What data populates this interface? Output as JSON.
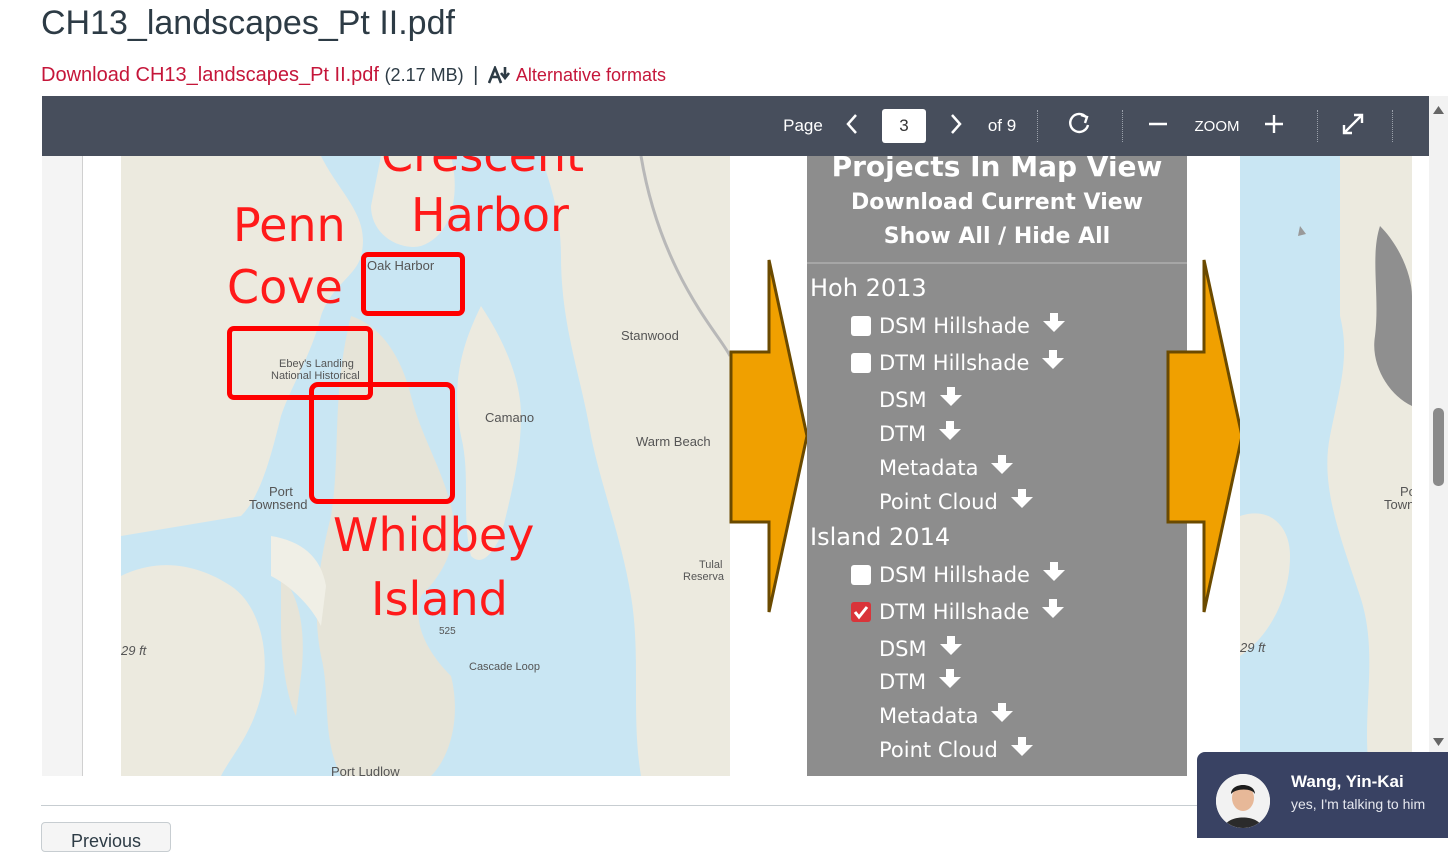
{
  "file": {
    "title": "CH13_landscapes_Pt II.pdf",
    "download_label": "Download CH13_landscapes_Pt II.pdf",
    "size": "(2.17 MB)",
    "separator": "|",
    "alt_formats_label": "Alternative formats",
    "alt_formats_icon": "accessibility-download-icon"
  },
  "toolbar": {
    "page_label": "Page",
    "page_value": "3",
    "of_label": "of 9",
    "zoom_label": "ZOOM",
    "icons": [
      "chevron-left-icon",
      "chevron-right-icon",
      "rotate-icon",
      "zoom-out-icon",
      "zoom-in-icon",
      "fullscreen-icon"
    ]
  },
  "slide": {
    "map_labels": {
      "crescent": "Crescent",
      "harbor": "Harbor",
      "penn": "Penn",
      "cove": "Cove",
      "whidbey": "Whidbey",
      "island": "Island",
      "oak_harbor": "Oak Harbor",
      "stanwood": "Stanwood",
      "ebeys_1": "Ebey's Landing",
      "ebeys_2": "National Historical",
      "camano": "Camano",
      "warm_beach": "Warm Beach",
      "port_townsend_1": "Port",
      "port_townsend_2": "Townsend",
      "tulalip_1": "Tulal",
      "tulalip_2": "Reserva",
      "cascade_loop": "Cascade Loop",
      "route_525": "525",
      "depth": "29 ft",
      "port_ludlow": "Port Ludlow",
      "right_port_1": "Port",
      "right_port_2": "Townse",
      "right_depth": "29 ft"
    },
    "panel": {
      "title": "Projects In Map View",
      "download_view": "Download Current View",
      "show_hide": "Show All / Hide All",
      "sections": [
        {
          "name": "Hoh 2013",
          "items": [
            {
              "label": "DSM Hillshade",
              "checkbox": true,
              "checked": false
            },
            {
              "label": "DTM Hillshade",
              "checkbox": true,
              "checked": false
            },
            {
              "label": "DSM",
              "checkbox": false
            },
            {
              "label": "DTM",
              "checkbox": false
            },
            {
              "label": "Metadata",
              "checkbox": false
            },
            {
              "label": "Point Cloud",
              "checkbox": false
            }
          ]
        },
        {
          "name": "Island 2014",
          "items": [
            {
              "label": "DSM Hillshade",
              "checkbox": true,
              "checked": false
            },
            {
              "label": "DTM Hillshade",
              "checkbox": true,
              "checked": true
            },
            {
              "label": "DSM",
              "checkbox": false
            },
            {
              "label": "DTM",
              "checkbox": false
            },
            {
              "label": "Metadata",
              "checkbox": false
            },
            {
              "label": "Point Cloud",
              "checkbox": false
            }
          ]
        }
      ]
    },
    "colors": {
      "arrow_fill": "#f0a000",
      "arrow_outline": "#6b4a00",
      "highlight_red": "#ff0000",
      "panel_gray": "#8d8d8d"
    }
  },
  "footer": {
    "previous_label": "Previous"
  },
  "chat": {
    "name": "Wang, Yin-Kai",
    "message": "yes, I'm talking to him"
  }
}
